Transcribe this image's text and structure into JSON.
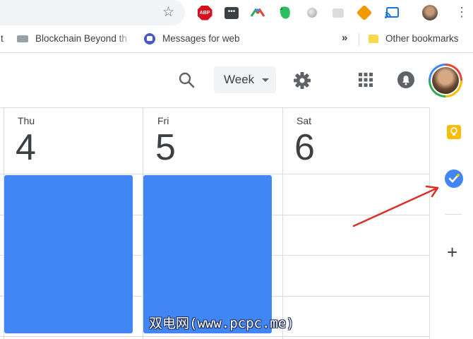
{
  "browser": {
    "bookmarks": {
      "partial_first": "t",
      "item1": "Blockchain Beyond th",
      "item2": "Messages for web",
      "more": "»",
      "other": "Other bookmarks"
    },
    "extensions": {
      "abp_label": "ABP",
      "dots_label": "•••"
    }
  },
  "header": {
    "view_select": "Week"
  },
  "days": [
    {
      "dow": "Thu",
      "num": "4"
    },
    {
      "dow": "Fri",
      "num": "5"
    },
    {
      "dow": "Sat",
      "num": "6"
    }
  ],
  "side_panel": {
    "add_label": "+"
  },
  "colors": {
    "event": "#4285f4",
    "keep": "#fbbc04",
    "tasks": "#4285f4",
    "annotation_arrow": "#d93025"
  },
  "watermark": "双电网(www.pcpc.me)"
}
